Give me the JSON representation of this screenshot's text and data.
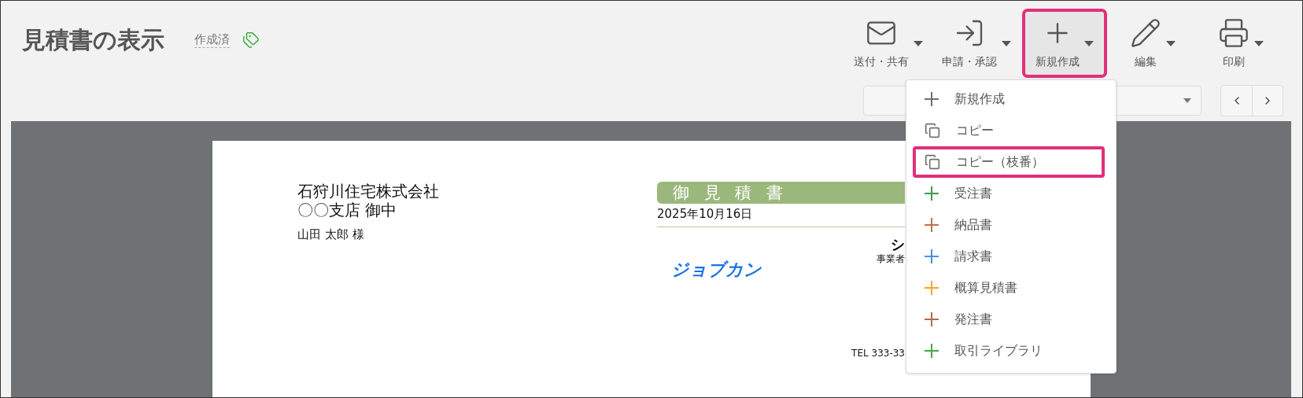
{
  "header": {
    "title": "見積書の表示",
    "status": "作成済"
  },
  "toolbar": [
    {
      "kind": "mail",
      "label": "送付・共有",
      "highlighted": false
    },
    {
      "kind": "enter",
      "label": "申請・承認",
      "highlighted": false
    },
    {
      "kind": "plus",
      "label": "新規作成",
      "highlighted": true
    },
    {
      "kind": "pencil",
      "label": "編集",
      "highlighted": false
    },
    {
      "kind": "printer",
      "label": "印刷",
      "highlighted": false
    }
  ],
  "document": {
    "recipient_company": "石狩川住宅株式会社",
    "recipient_branch": "〇〇支店 御中",
    "recipient_person": "山田 太郎 様",
    "title": "御 見 積 書",
    "date": "2025年10月16日",
    "logo": "ジョブカン",
    "issuer_name": "シ",
    "issuer_label": "事業者",
    "issuer_tel": "TEL 333-33"
  },
  "menu": [
    {
      "kind": "plus",
      "label": "新規作成",
      "color": "#707070",
      "highlighted": false
    },
    {
      "kind": "copy",
      "label": "コピー",
      "color": "#707070",
      "highlighted": false
    },
    {
      "kind": "copy",
      "label": "コピー（枝番）",
      "color": "#707070",
      "highlighted": true
    },
    {
      "kind": "plus",
      "label": "受注書",
      "color": "#3f9a4f",
      "highlighted": false
    },
    {
      "kind": "plus",
      "label": "納品書",
      "color": "#c0714f",
      "highlighted": false
    },
    {
      "kind": "plus",
      "label": "請求書",
      "color": "#4a90e2",
      "highlighted": false
    },
    {
      "kind": "plus",
      "label": "概算見積書",
      "color": "#f5a623",
      "highlighted": false
    },
    {
      "kind": "plus",
      "label": "発注書",
      "color": "#b36b4c",
      "highlighted": false
    },
    {
      "kind": "plus",
      "label": "取引ライブラリ",
      "color": "#45a845",
      "highlighted": false
    }
  ]
}
